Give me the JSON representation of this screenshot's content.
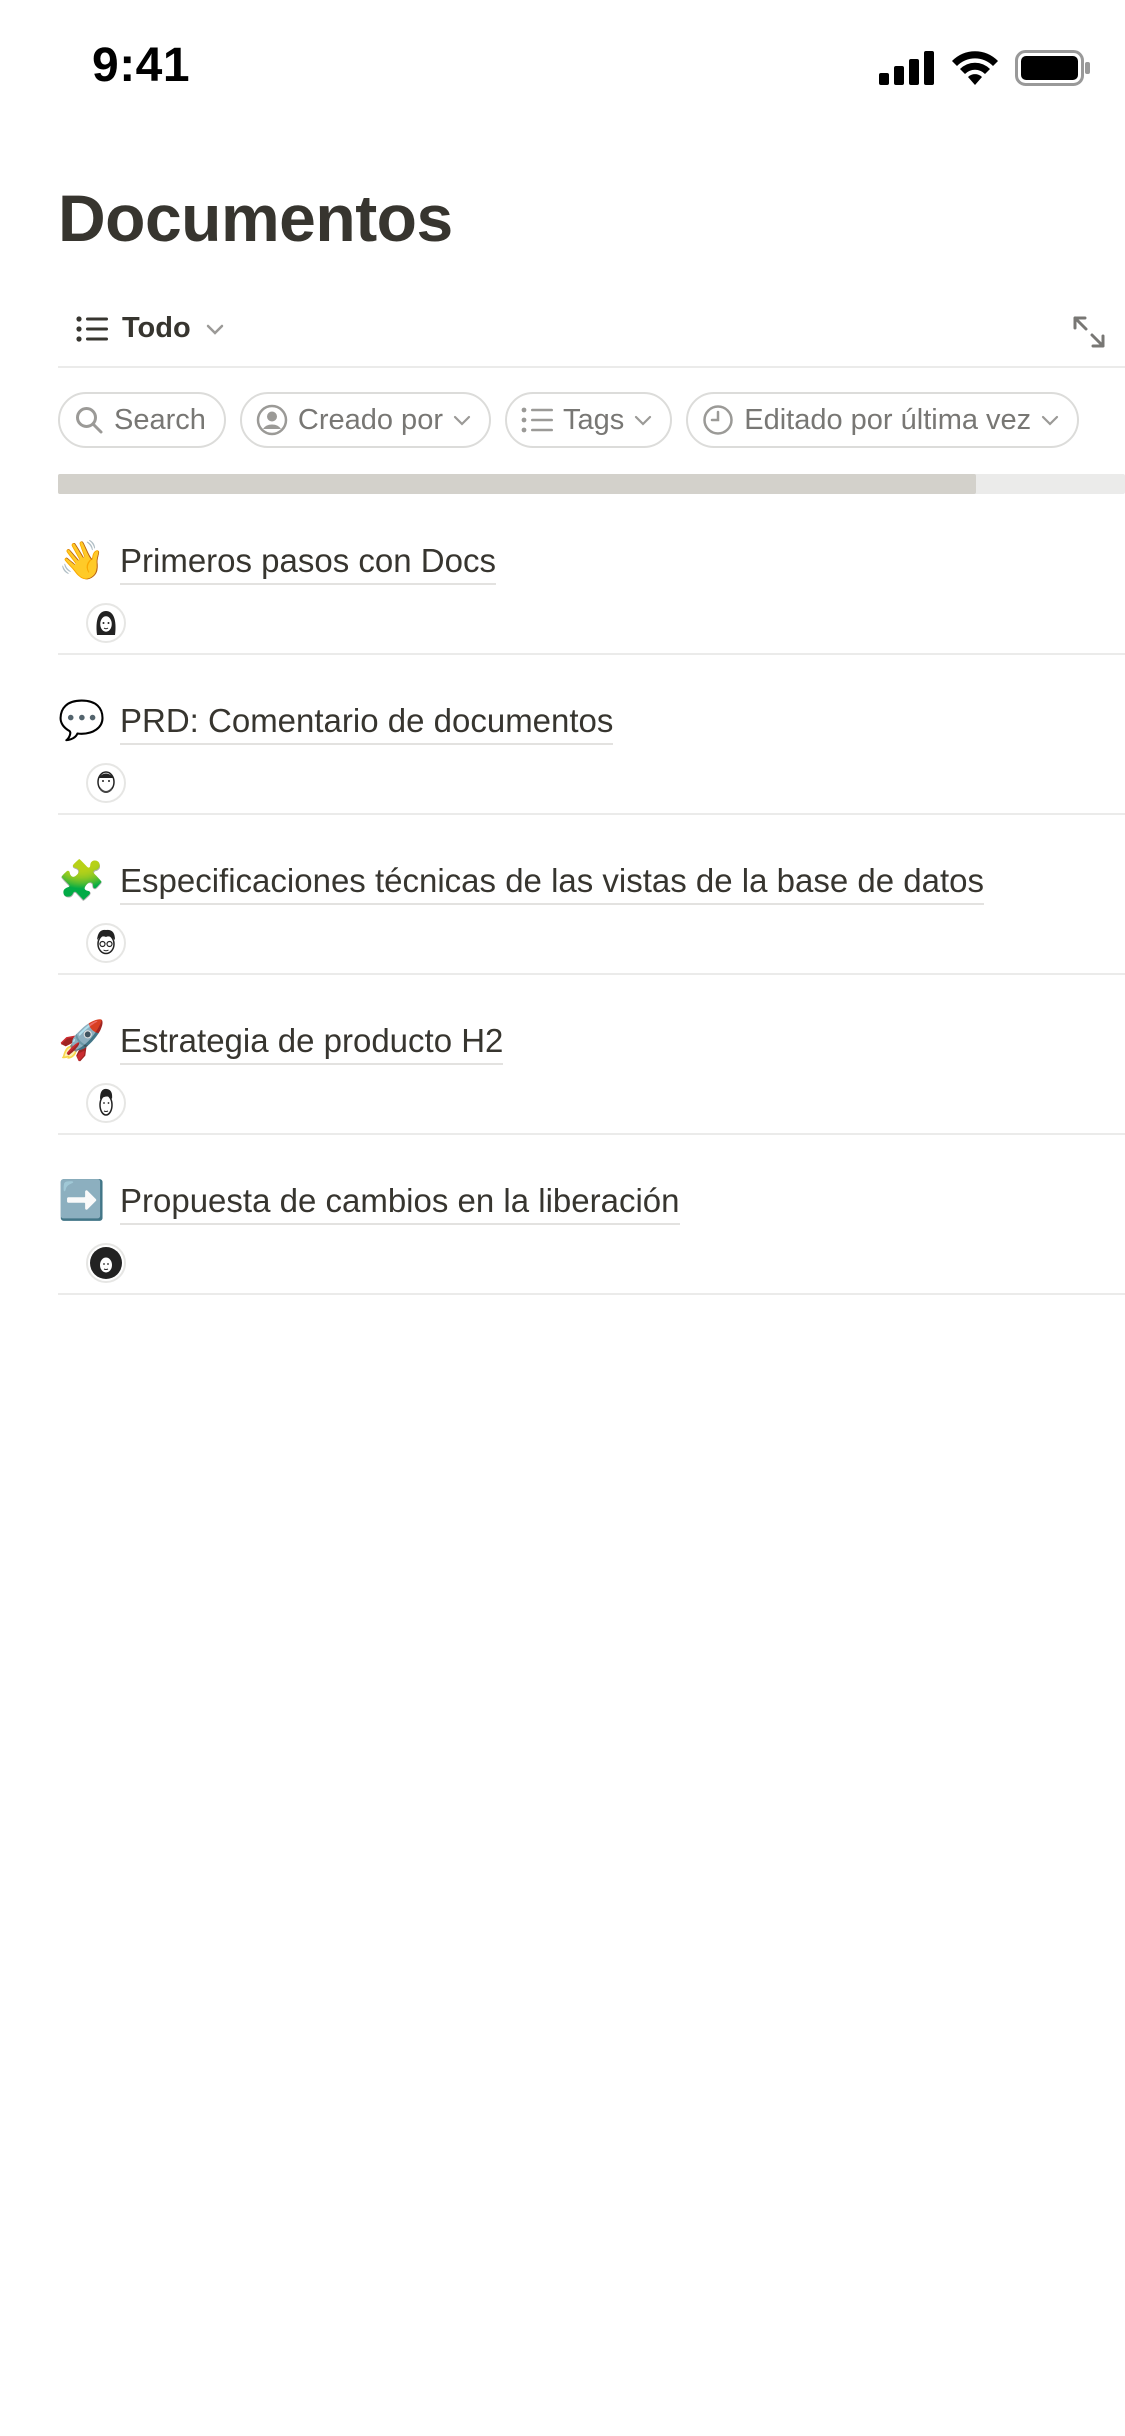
{
  "status": {
    "time": "9:41"
  },
  "page": {
    "title": "Documentos"
  },
  "view": {
    "label": "Todo",
    "list_icon": "list-icon",
    "chevron_icon": "chevron-down-icon",
    "expand_icon": "expand-icon"
  },
  "filters": [
    {
      "label": "Search",
      "icon": "search-icon"
    },
    {
      "label": "Creado por",
      "icon": "person-icon"
    },
    {
      "label": "Tags",
      "icon": "list-icon"
    },
    {
      "label": "Editado por última vez",
      "icon": "clock-icon"
    }
  ],
  "scroll": {
    "position_fraction": 0.86
  },
  "documents": [
    {
      "emoji": "👋",
      "title": "Primeros pasos con Docs",
      "avatar": "avatar-woman"
    },
    {
      "emoji": "💬",
      "title": "PRD: Comentario de documentos",
      "avatar": "avatar-bearded-man"
    },
    {
      "emoji": "🧩",
      "title": "Especificaciones técnicas de las vistas de la base de datos",
      "avatar": "avatar-man-glasses"
    },
    {
      "emoji": "🚀",
      "title": "Estrategia de producto H2",
      "avatar": "avatar-man-tall-hair"
    },
    {
      "emoji": "➡️",
      "title": "Propuesta de cambios en la liberación",
      "avatar": "avatar-woman-curly"
    }
  ],
  "colors": {
    "text": "#37352f",
    "muted": "#787774",
    "divider": "#ebebea"
  }
}
